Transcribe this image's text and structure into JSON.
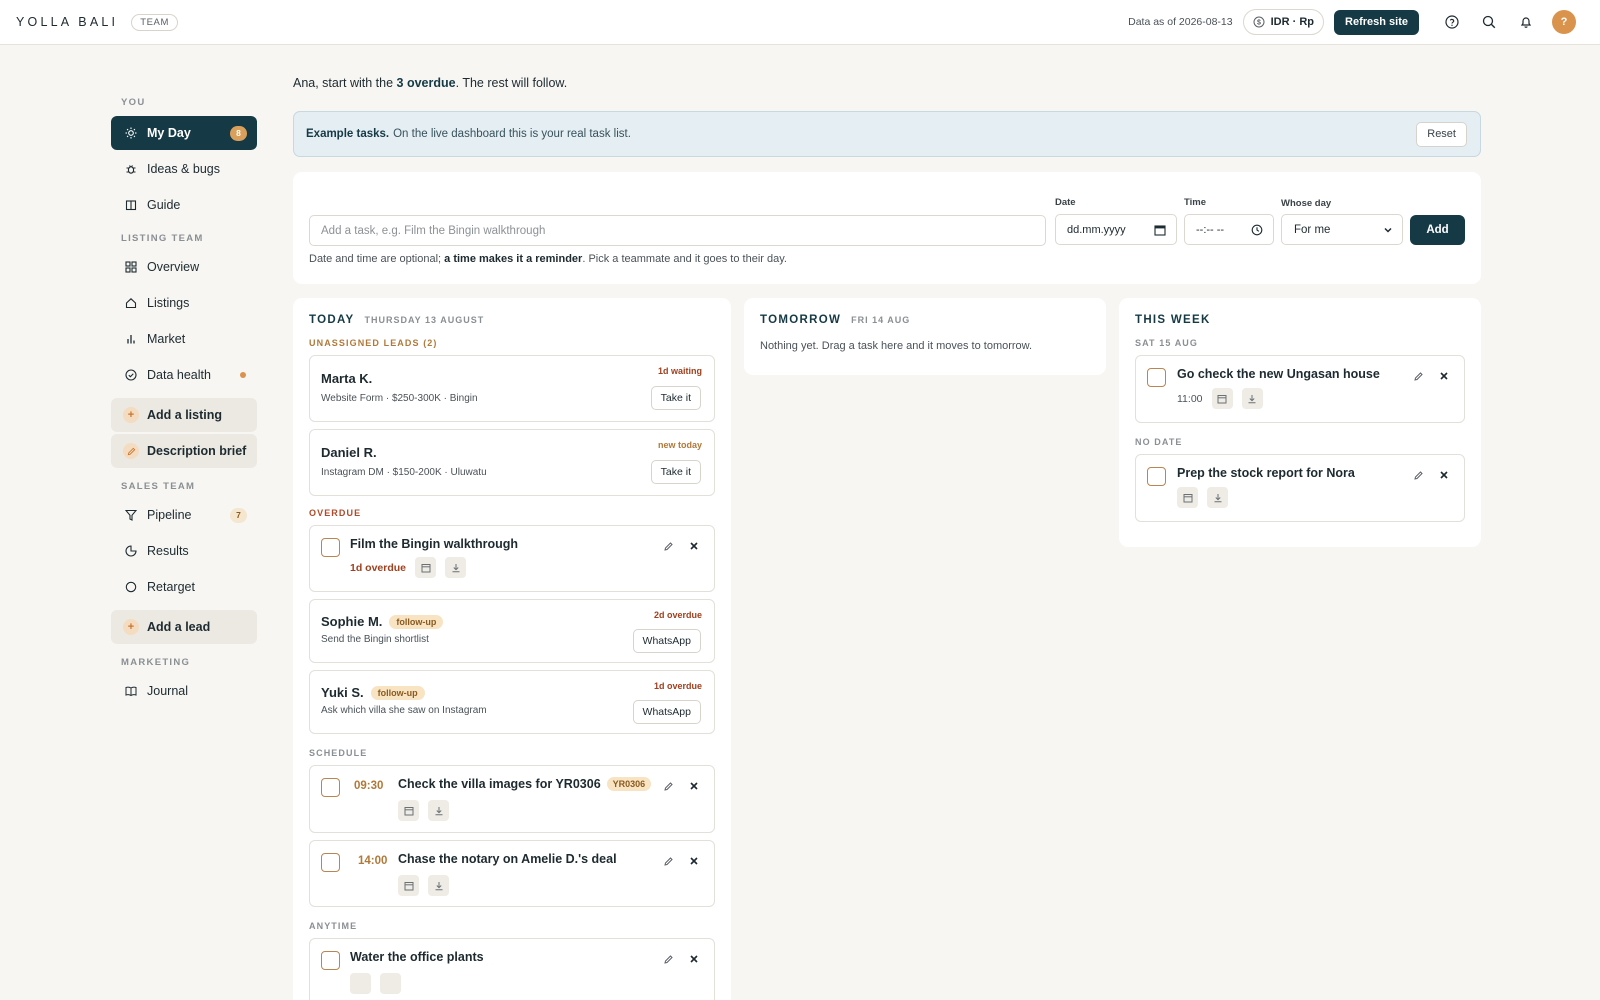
{
  "header": {
    "brand": "YOLLA BALI",
    "team_badge": "TEAM",
    "data_as_of": "Data as of 2026-08-13",
    "currency": "IDR · Rp",
    "refresh_label": "Refresh site",
    "avatar_initial": "?"
  },
  "sidebar": {
    "sections": {
      "you": "YOU",
      "listing": "LISTING TEAM",
      "sales": "SALES TEAM",
      "marketing": "MARKETING"
    },
    "items": {
      "my_day": {
        "label": "My Day",
        "badge": "8"
      },
      "ideas": {
        "label": "Ideas & bugs"
      },
      "guide": {
        "label": "Guide"
      },
      "overview": {
        "label": "Overview"
      },
      "listings": {
        "label": "Listings"
      },
      "market": {
        "label": "Market"
      },
      "data_health": {
        "label": "Data health"
      },
      "add_listing": {
        "label": "Add a listing"
      },
      "description_brief": {
        "label": "Description brief"
      },
      "pipeline": {
        "label": "Pipeline",
        "badge": "7"
      },
      "results": {
        "label": "Results"
      },
      "retarget": {
        "label": "Retarget"
      },
      "add_lead": {
        "label": "Add a lead"
      },
      "journal": {
        "label": "Journal"
      }
    }
  },
  "greeting": {
    "prefix": "Ana, start with the ",
    "emphasis": "3 overdue",
    "suffix": ". The rest will follow."
  },
  "banner": {
    "title": "Example tasks.",
    "text": "On the live dashboard this is your real task list.",
    "reset_label": "Reset"
  },
  "add_task": {
    "placeholder": "Add a task, e.g. Film the Bingin walkthrough",
    "date_label": "Date",
    "date_placeholder": "dd.mm.yyyy",
    "time_label": "Time",
    "time_placeholder": "--:-- --",
    "whose_label": "Whose day",
    "whose_value": "For me",
    "add_label": "Add",
    "hint_prefix": "Date and time are optional; ",
    "hint_bold": "a time makes it a reminder",
    "hint_suffix": ". Pick a teammate and it goes to their day."
  },
  "today": {
    "title": "TODAY",
    "date": "THURSDAY 13 AUGUST",
    "unassigned_label": "UNASSIGNED LEADS (2)",
    "leads": [
      {
        "name": "Marta K.",
        "detail": "Website Form · $250-300K · Bingin",
        "tag": "1d waiting",
        "action": "Take it"
      },
      {
        "name": "Daniel R.",
        "detail": "Instagram DM · $150-200K · Uluwatu",
        "tag": "new today",
        "action": "Take it"
      }
    ],
    "overdue_label": "OVERDUE",
    "overdue_task": {
      "title": "Film the Bingin walkthrough",
      "status": "1d overdue"
    },
    "followups": [
      {
        "name": "Sophie M.",
        "pill": "follow-up",
        "detail": "Send the Bingin shortlist",
        "tag": "2d overdue",
        "action": "WhatsApp"
      },
      {
        "name": "Yuki S.",
        "pill": "follow-up",
        "detail": "Ask which villa she saw on Instagram",
        "tag": "1d overdue",
        "action": "WhatsApp"
      }
    ],
    "schedule_label": "SCHEDULE",
    "schedule": [
      {
        "time": "09:30",
        "title": "Check the villa images for YR0306",
        "ref": "YR0306"
      },
      {
        "time": "14:00",
        "title": "Chase the notary on Amelie D.'s deal",
        "ref": ""
      }
    ],
    "anytime_label": "ANYTIME",
    "anytime": [
      {
        "title": "Water the office plants"
      }
    ]
  },
  "tomorrow": {
    "title": "TOMORROW",
    "date": "FRI 14 AUG",
    "empty": "Nothing yet. Drag a task here and it moves to tomorrow."
  },
  "this_week": {
    "title": "THIS WEEK",
    "groups": [
      {
        "label": "SAT 15 AUG",
        "task": {
          "title": "Go check the new Ungasan house",
          "time": "11:00"
        }
      },
      {
        "label": "NO DATE",
        "task": {
          "title": "Prep the stock report for Nora",
          "time": ""
        }
      }
    ]
  },
  "colors": {
    "primary": "#153a45",
    "accent": "#d9934c",
    "overdue": "#a0401e",
    "background": "#f7f6f3"
  }
}
